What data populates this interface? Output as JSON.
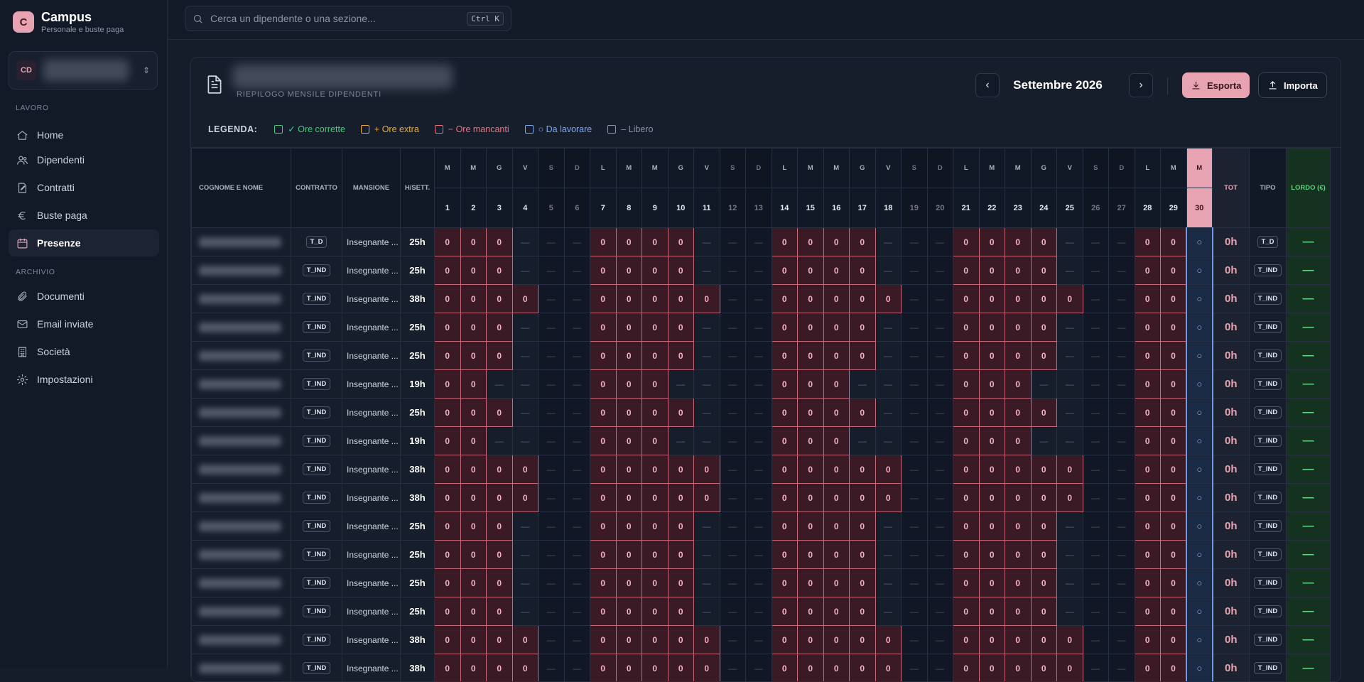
{
  "app": {
    "name": "Campus",
    "subtitle": "Personale e buste paga"
  },
  "company": {
    "initials": "CD"
  },
  "sidebar": {
    "sections": [
      {
        "label": "LAVORO",
        "items": [
          {
            "label": "Home",
            "icon": "home-icon"
          },
          {
            "label": "Dipendenti",
            "icon": "users-icon"
          },
          {
            "label": "Contratti",
            "icon": "contract-icon"
          },
          {
            "label": "Buste paga",
            "icon": "euro-icon"
          },
          {
            "label": "Presenze",
            "icon": "calendar-icon",
            "active": true
          }
        ]
      },
      {
        "label": "ARCHIVIO",
        "items": [
          {
            "label": "Documenti",
            "icon": "paperclip-icon"
          },
          {
            "label": "Email inviate",
            "icon": "mail-icon"
          },
          {
            "label": "Società",
            "icon": "building-icon"
          },
          {
            "label": "Impostazioni",
            "icon": "gear-icon"
          }
        ]
      }
    ]
  },
  "search": {
    "placeholder": "Cerca un dipendente o una sezione...",
    "shortcut": "Ctrl K"
  },
  "header": {
    "subtitle": "RIEPILOGO MENSILE DIPENDENTI",
    "month": "Settembre 2026",
    "export_label": "Esporta",
    "import_label": "Importa"
  },
  "legend": {
    "title": "LEGENDA:",
    "items": [
      {
        "label": "✓ Ore corrette",
        "color": "#4cc97a"
      },
      {
        "label": "+ Ore extra",
        "color": "#e9a93a"
      },
      {
        "label": "− Ore mancanti",
        "color": "#e9707f"
      },
      {
        "label": "○ Da lavorare",
        "color": "#7ea6f0"
      },
      {
        "label": "– Libero",
        "color": "#8b95a6"
      }
    ]
  },
  "table": {
    "headers": {
      "name": "COGNOME E NOME",
      "contract": "CONTRATTO",
      "role": "MANSIONE",
      "hours": "H/SETT.",
      "total": "TOT",
      "type": "TIPO",
      "gross": "LORDO (€)"
    },
    "weekdays": [
      "M",
      "M",
      "G",
      "V",
      "S",
      "D",
      "L",
      "M",
      "M",
      "G",
      "V",
      "S",
      "D",
      "L",
      "M",
      "M",
      "G",
      "V",
      "S",
      "D",
      "L",
      "M",
      "M",
      "G",
      "V",
      "S",
      "D",
      "L",
      "M",
      "M"
    ],
    "selected_day": 30,
    "cell_missing": "0",
    "cell_free": "—",
    "cell_todo": "○",
    "rows": [
      {
        "contract": "T_D",
        "role": "Insegnante ...",
        "hours": "25h",
        "total": "0h",
        "gross": "—",
        "fmask": [
          1,
          1,
          1,
          1,
          0
        ]
      },
      {
        "contract": "T_IND",
        "role": "Insegnante ...",
        "hours": "25h",
        "total": "0h",
        "gross": "—",
        "fmask": [
          1,
          1,
          1,
          1,
          0
        ]
      },
      {
        "contract": "T_IND",
        "role": "Insegnante ...",
        "hours": "38h",
        "total": "0h",
        "gross": "—",
        "fmask": [
          1,
          1,
          1,
          1,
          1
        ]
      },
      {
        "contract": "T_IND",
        "role": "Insegnante ...",
        "hours": "25h",
        "total": "0h",
        "gross": "—",
        "fmask": [
          1,
          1,
          1,
          1,
          0
        ]
      },
      {
        "contract": "T_IND",
        "role": "Insegnante ...",
        "hours": "25h",
        "total": "0h",
        "gross": "—",
        "fmask": [
          1,
          1,
          1,
          1,
          0
        ]
      },
      {
        "contract": "T_IND",
        "role": "Insegnante ...",
        "hours": "19h",
        "total": "0h",
        "gross": "—",
        "fmask": [
          1,
          1,
          1,
          0,
          0
        ]
      },
      {
        "contract": "T_IND",
        "role": "Insegnante ...",
        "hours": "25h",
        "total": "0h",
        "gross": "—",
        "fmask": [
          1,
          1,
          1,
          1,
          0
        ]
      },
      {
        "contract": "T_IND",
        "role": "Insegnante ...",
        "hours": "19h",
        "total": "0h",
        "gross": "—",
        "fmask": [
          1,
          1,
          1,
          0,
          0
        ]
      },
      {
        "contract": "T_IND",
        "role": "Insegnante ...",
        "hours": "38h",
        "total": "0h",
        "gross": "—",
        "fmask": [
          1,
          1,
          1,
          1,
          1
        ]
      },
      {
        "contract": "T_IND",
        "role": "Insegnante ...",
        "hours": "38h",
        "total": "0h",
        "gross": "—",
        "fmask": [
          1,
          1,
          1,
          1,
          1
        ]
      },
      {
        "contract": "T_IND",
        "role": "Insegnante ...",
        "hours": "25h",
        "total": "0h",
        "gross": "—",
        "fmask": [
          1,
          1,
          1,
          1,
          0
        ]
      },
      {
        "contract": "T_IND",
        "role": "Insegnante ...",
        "hours": "25h",
        "total": "0h",
        "gross": "—",
        "fmask": [
          1,
          1,
          1,
          1,
          0
        ]
      },
      {
        "contract": "T_IND",
        "role": "Insegnante ...",
        "hours": "25h",
        "total": "0h",
        "gross": "—",
        "fmask": [
          1,
          1,
          1,
          1,
          0
        ]
      },
      {
        "contract": "T_IND",
        "role": "Insegnante ...",
        "hours": "25h",
        "total": "0h",
        "gross": "—",
        "fmask": [
          1,
          1,
          1,
          1,
          0
        ]
      },
      {
        "contract": "T_IND",
        "role": "Insegnante ...",
        "hours": "38h",
        "total": "0h",
        "gross": "—",
        "fmask": [
          1,
          1,
          1,
          1,
          1
        ]
      },
      {
        "contract": "T_IND",
        "role": "Insegnante ...",
        "hours": "38h",
        "total": "0h",
        "gross": "—",
        "fmask": [
          1,
          1,
          1,
          1,
          1
        ]
      }
    ]
  }
}
